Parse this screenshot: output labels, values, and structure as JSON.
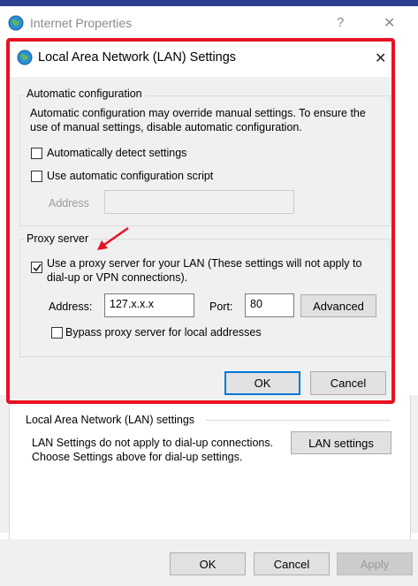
{
  "parent_window": {
    "title": "Internet Properties",
    "help_symbol": "?",
    "close_symbol": "✕",
    "lan_section": {
      "title": "Local Area Network (LAN) settings",
      "description": "LAN Settings do not apply to dial-up connections. Choose Settings above for dial-up settings.",
      "lan_button": "LAN settings"
    },
    "footer": {
      "ok": "OK",
      "cancel": "Cancel",
      "apply": "Apply"
    }
  },
  "dialog": {
    "title": "Local Area Network (LAN) Settings",
    "close_symbol": "✕",
    "auto_config": {
      "title": "Automatic configuration",
      "description": "Automatic configuration may override manual settings.  To ensure the use of manual settings, disable automatic configuration.",
      "detect_label": "Automatically detect settings",
      "detect_checked": false,
      "script_label": "Use automatic configuration script",
      "script_checked": false,
      "address_label": "Address",
      "address_value": ""
    },
    "proxy": {
      "title": "Proxy server",
      "use_proxy_label": "Use a proxy server for your LAN (These settings will not apply to dial-up or VPN connections).",
      "use_proxy_checked": true,
      "address_label": "Address:",
      "address_value": "127.x.x.x",
      "port_label": "Port:",
      "port_value": "80",
      "advanced_button": "Advanced",
      "bypass_label": "Bypass proxy server for local addresses",
      "bypass_checked": false
    },
    "ok": "OK",
    "cancel": "Cancel"
  },
  "colors": {
    "highlight": "#e81123",
    "accent": "#0078d7",
    "window_bg": "#f0f0f0"
  }
}
